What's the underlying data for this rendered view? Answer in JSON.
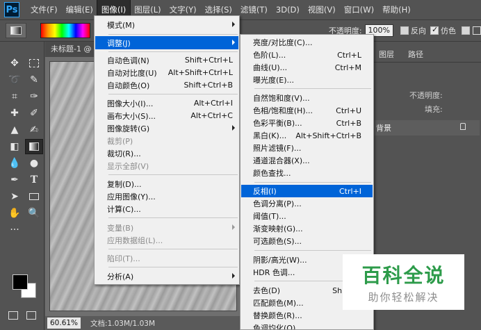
{
  "menubar": {
    "app_logo": "Ps",
    "items": [
      "文件(F)",
      "编辑(E)",
      "图像(I)",
      "图层(L)",
      "文字(Y)",
      "选择(S)",
      "滤镜(T)",
      "3D(D)",
      "视图(V)",
      "窗口(W)",
      "帮助(H)"
    ],
    "active_index": 2
  },
  "options_bar": {
    "opacity_label": "不透明度:",
    "opacity_value": "100%",
    "reverse_label": "反向",
    "dither_label": "仿色",
    "reverse_checked": false,
    "dither_checked": true
  },
  "document": {
    "tab_title": "未标题-1 @",
    "zoom": "60.61%",
    "doc_info": "文档:1.03M/1.03M"
  },
  "right_panel": {
    "tabs": [
      "图层",
      "路径"
    ],
    "opacity_label": "不透明度:",
    "fill_label": "填充:",
    "layer_name": "背景"
  },
  "image_menu": {
    "items": [
      {
        "label": "模式(M)",
        "shortcut": "",
        "submenu": true,
        "disabled": false
      },
      {
        "label": "调整(J)",
        "shortcut": "",
        "submenu": true,
        "disabled": false,
        "highlighted": true
      },
      {
        "label": "自动色调(N)",
        "shortcut": "Shift+Ctrl+L"
      },
      {
        "label": "自动对比度(U)",
        "shortcut": "Alt+Shift+Ctrl+L"
      },
      {
        "label": "自动颜色(O)",
        "shortcut": "Shift+Ctrl+B"
      },
      {
        "label": "图像大小(I)...",
        "shortcut": "Alt+Ctrl+I"
      },
      {
        "label": "画布大小(S)...",
        "shortcut": "Alt+Ctrl+C"
      },
      {
        "label": "图像旋转(G)",
        "shortcut": "",
        "submenu": true
      },
      {
        "label": "裁剪(P)",
        "shortcut": "",
        "disabled": true
      },
      {
        "label": "裁切(R)...",
        "shortcut": ""
      },
      {
        "label": "显示全部(V)",
        "shortcut": "",
        "disabled": true
      },
      {
        "label": "复制(D)...",
        "shortcut": ""
      },
      {
        "label": "应用图像(Y)...",
        "shortcut": ""
      },
      {
        "label": "计算(C)...",
        "shortcut": ""
      },
      {
        "label": "变量(B)",
        "shortcut": "",
        "submenu": true,
        "disabled": true
      },
      {
        "label": "应用数据组(L)...",
        "shortcut": "",
        "disabled": true
      },
      {
        "label": "陷印(T)...",
        "shortcut": "",
        "disabled": true
      },
      {
        "label": "分析(A)",
        "shortcut": "",
        "submenu": true
      }
    ]
  },
  "adjust_menu": {
    "items": [
      {
        "label": "亮度/对比度(C)...",
        "shortcut": ""
      },
      {
        "label": "色阶(L)...",
        "shortcut": "Ctrl+L"
      },
      {
        "label": "曲线(U)...",
        "shortcut": "Ctrl+M"
      },
      {
        "label": "曝光度(E)...",
        "shortcut": ""
      },
      {
        "label": "自然饱和度(V)...",
        "shortcut": ""
      },
      {
        "label": "色相/饱和度(H)...",
        "shortcut": "Ctrl+U"
      },
      {
        "label": "色彩平衡(B)...",
        "shortcut": "Ctrl+B"
      },
      {
        "label": "黑白(K)...",
        "shortcut": "Alt+Shift+Ctrl+B"
      },
      {
        "label": "照片滤镜(F)...",
        "shortcut": ""
      },
      {
        "label": "通道混合器(X)...",
        "shortcut": ""
      },
      {
        "label": "颜色查找...",
        "shortcut": ""
      },
      {
        "label": "反相(I)",
        "shortcut": "Ctrl+I",
        "highlighted": true
      },
      {
        "label": "色调分离(P)...",
        "shortcut": ""
      },
      {
        "label": "阈值(T)...",
        "shortcut": ""
      },
      {
        "label": "渐变映射(G)...",
        "shortcut": ""
      },
      {
        "label": "可选颜色(S)...",
        "shortcut": ""
      },
      {
        "label": "阴影/高光(W)...",
        "shortcut": ""
      },
      {
        "label": "HDR 色调...",
        "shortcut": ""
      },
      {
        "label": "去色(D)",
        "shortcut": "Shift+C"
      },
      {
        "label": "匹配颜色(M)...",
        "shortcut": ""
      },
      {
        "label": "替换颜色(R)...",
        "shortcut": ""
      },
      {
        "label": "色调均化(Q)",
        "shortcut": ""
      }
    ]
  },
  "watermark": {
    "title": "百科全说",
    "subtitle": "助你轻松解决"
  },
  "colors": {
    "menu_highlight": "#0064d8",
    "ui_gray": "#535353",
    "watermark_green": "#2d9b4a"
  }
}
